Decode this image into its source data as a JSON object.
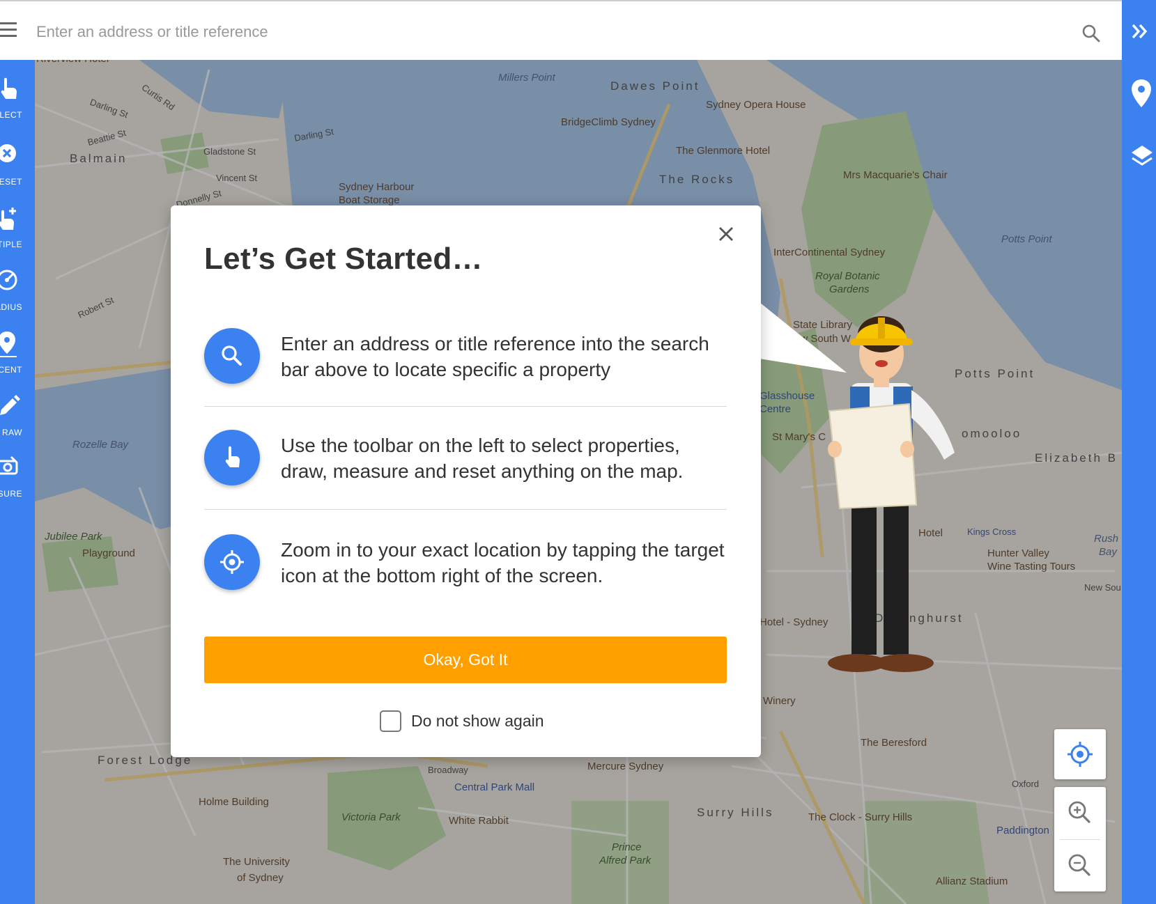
{
  "search": {
    "placeholder": "Enter an address or title reference"
  },
  "left_toolbar": {
    "items": [
      {
        "label": "LECT",
        "icon": "hand-pointer-icon"
      },
      {
        "label": "ESET",
        "icon": "reset-x-icon"
      },
      {
        "label": "LTIPLE",
        "icon": "multiple-select-icon"
      },
      {
        "label": "ADIUS",
        "icon": "radius-icon"
      },
      {
        "label": "ACENT",
        "icon": "adjacent-pin-icon"
      },
      {
        "label": "RAW",
        "icon": "pencil-icon"
      },
      {
        "label": "ASURE",
        "icon": "measure-icon"
      }
    ]
  },
  "right_bar": {
    "icons": [
      "expand-chevrons-icon",
      "location-pin-icon",
      "layers-icon"
    ]
  },
  "map": {
    "labels": [
      {
        "text": "Riverview Hotel",
        "cls": "poi"
      },
      {
        "text": "Millers Point",
        "cls": "water"
      },
      {
        "text": "Dawes Point",
        "cls": "suburb"
      },
      {
        "text": "Sydney Opera House",
        "cls": "poi"
      },
      {
        "text": "BridgeClimb Sydney",
        "cls": "poi"
      },
      {
        "text": "The Glenmore Hotel",
        "cls": "poi"
      },
      {
        "text": "The Rocks",
        "cls": "suburb"
      },
      {
        "text": "Mrs Macquarie's Chair",
        "cls": "poi"
      },
      {
        "text": "Balmain",
        "cls": "suburb"
      },
      {
        "text": "Darling St",
        "cls": "road"
      },
      {
        "text": "Curtis Rd",
        "cls": "road"
      },
      {
        "text": "Beattie St",
        "cls": "road"
      },
      {
        "text": "Gladstone St",
        "cls": "road"
      },
      {
        "text": "Vincent St",
        "cls": "road"
      },
      {
        "text": "Darling St",
        "cls": "road"
      },
      {
        "text": "Sydney Harbour",
        "cls": "poi"
      },
      {
        "text": "Boat Storage",
        "cls": "poi"
      },
      {
        "text": "Donnelly St",
        "cls": "road"
      },
      {
        "text": "Potts Point",
        "cls": "water"
      },
      {
        "text": "InterContinental Sydney",
        "cls": "poi"
      },
      {
        "text": "Royal Botanic",
        "cls": "park"
      },
      {
        "text": "Gardens",
        "cls": "park"
      },
      {
        "text": "State Library",
        "cls": "poi"
      },
      {
        "text": "ew South W",
        "cls": "poi"
      },
      {
        "text": "Potts Point",
        "cls": "suburb"
      },
      {
        "text": "Glasshouse",
        "cls": "poiblue"
      },
      {
        "text": "Centre",
        "cls": "poiblue"
      },
      {
        "text": "St Mary's C",
        "cls": "poi"
      },
      {
        "text": "omooloo",
        "cls": "suburb"
      },
      {
        "text": "Elizabeth B",
        "cls": "suburb"
      },
      {
        "text": "Robert St",
        "cls": "road"
      },
      {
        "text": "Rozelle Bay",
        "cls": "water"
      },
      {
        "text": "Jubilee Park",
        "cls": "park"
      },
      {
        "text": "Playground",
        "cls": "poi"
      },
      {
        "text": "Hotel",
        "cls": "poi"
      },
      {
        "text": "Kings Cross",
        "cls": "poiblue"
      },
      {
        "text": "Hunter Valley",
        "cls": "poi"
      },
      {
        "text": "Wine Tasting Tours",
        "cls": "poi"
      },
      {
        "text": "Rush",
        "cls": "water"
      },
      {
        "text": "Bay",
        "cls": "water"
      },
      {
        "text": "Hotel - Sydney",
        "cls": "poi"
      },
      {
        "text": "Darlinghurst",
        "cls": "suburb"
      },
      {
        "text": "Winery",
        "cls": "poi"
      },
      {
        "text": "The Beresford",
        "cls": "poi"
      },
      {
        "text": "Forest Lodge",
        "cls": "suburb"
      },
      {
        "text": "Mercure Sydney",
        "cls": "poi"
      },
      {
        "text": "Central Park Mall",
        "cls": "poiblue"
      },
      {
        "text": "Broadway",
        "cls": "road"
      },
      {
        "text": "Holme Building",
        "cls": "poi"
      },
      {
        "text": "Victoria Park",
        "cls": "park"
      },
      {
        "text": "White Rabbit",
        "cls": "poi"
      },
      {
        "text": "Surry Hills",
        "cls": "suburb"
      },
      {
        "text": "The Clock - Surry Hills",
        "cls": "poi"
      },
      {
        "text": "Paddington",
        "cls": "poiblue"
      },
      {
        "text": "Prince",
        "cls": "park"
      },
      {
        "text": "Alfred Park",
        "cls": "park"
      },
      {
        "text": "The University",
        "cls": "poi"
      },
      {
        "text": "of Sydney",
        "cls": "poi"
      },
      {
        "text": "Allianz Stadium",
        "cls": "poi"
      },
      {
        "text": "Oxford",
        "cls": "road"
      },
      {
        "text": "New Sou",
        "cls": "road"
      }
    ]
  },
  "modal": {
    "title": "Let’s Get Started…",
    "steps": [
      {
        "icon": "search-icon",
        "text": "Enter an address or title reference into the search bar above to locate specific a property"
      },
      {
        "icon": "hand-pointer-icon",
        "text": "Use the toolbar on the left to select properties, draw, measure and reset anything on the map."
      },
      {
        "icon": "target-icon",
        "text": "Zoom in to your exact location by tapping the target icon at the bottom right of the screen."
      }
    ],
    "ok_label": "Okay, Got It",
    "dont_show_label": "Do not show again",
    "dont_show_checked": false
  },
  "colors": {
    "accent_blue": "#3b82f0",
    "button_orange": "#ffa000"
  }
}
